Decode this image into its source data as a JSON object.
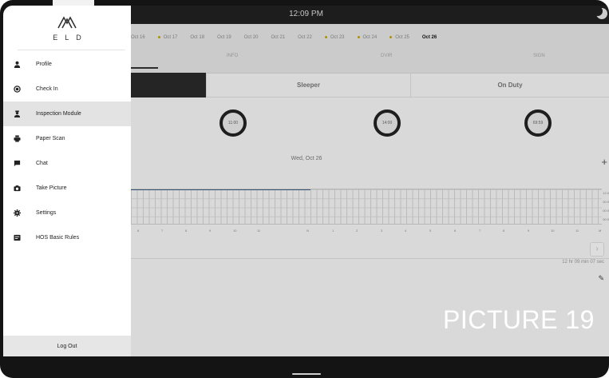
{
  "statusbar": {
    "time": "12:09 PM"
  },
  "dates": {
    "items": [
      "Oct 16",
      "Oct 17",
      "Oct 18",
      "Oct 19",
      "Oct 20",
      "Oct 21",
      "Oct 22",
      "Oct 23",
      "Oct 24",
      "Oct 25",
      "Oct 26"
    ],
    "marked": [
      "Oct 17",
      "Oct 23",
      "Oct 24",
      "Oct 25"
    ],
    "selected": "Oct 26",
    "marker_color": "#c6a400"
  },
  "stats": {
    "a": "INFO",
    "b": "DVIR",
    "c": "SIGN"
  },
  "status_tabs": [
    {
      "label": ""
    },
    {
      "label": "Sleeper"
    },
    {
      "label": "On Duty"
    }
  ],
  "clocks": {
    "a": "11:00",
    "b": "14:00",
    "c": "69:59"
  },
  "day": {
    "heading": "Wed, Oct 26"
  },
  "log_grid": {
    "hours": [
      "6",
      "7",
      "8",
      "9",
      "10",
      "11",
      "N",
      "1",
      "2",
      "3",
      "4",
      "5",
      "6",
      "7",
      "8",
      "9",
      "10",
      "11",
      "M"
    ],
    "right_totals": [
      "12:0",
      "00:0",
      "00:0",
      "00:0"
    ]
  },
  "plus_icon": "+",
  "pager_icon": "›",
  "duration": "12 hr 09 min 07 sec",
  "pencil_icon": "✎",
  "overlay_label": "PICTURE 19",
  "drawer": {
    "logo_text": "ELD",
    "menu": [
      {
        "label": "Profile",
        "icon": "person-icon"
      },
      {
        "label": "Check In",
        "icon": "check-in-icon"
      },
      {
        "label": "Inspection Module",
        "icon": "inspector-icon"
      },
      {
        "label": "Paper Scan",
        "icon": "printer-icon"
      },
      {
        "label": "Chat",
        "icon": "chat-icon"
      },
      {
        "label": "Take Picture",
        "icon": "camera-icon"
      },
      {
        "label": "Settings",
        "icon": "gear-icon"
      },
      {
        "label": "HOS Basic Rules",
        "icon": "book-icon"
      }
    ],
    "active_item": "Inspection Module",
    "logout_label": "Log Out"
  }
}
